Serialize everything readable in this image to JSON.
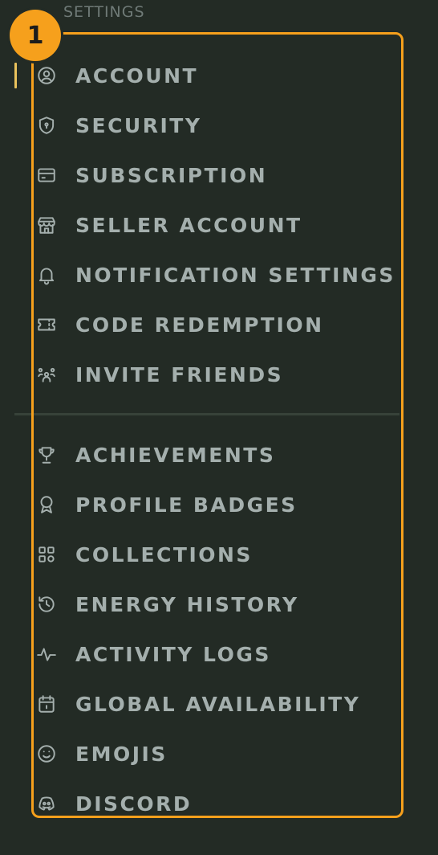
{
  "sidebar": {
    "section_header": "SETTINGS",
    "step_badge": "1",
    "colors": {
      "background": "#232b25",
      "text": "#a4afad",
      "header": "#6f7a77",
      "active_indicator": "#e9c25c",
      "highlight": "#f6a01c"
    },
    "group1": [
      {
        "label": "ACCOUNT",
        "icon": "user-circle-icon"
      },
      {
        "label": "SECURITY",
        "icon": "shield-icon"
      },
      {
        "label": "SUBSCRIPTION",
        "icon": "credit-card-icon"
      },
      {
        "label": "SELLER ACCOUNT",
        "icon": "store-icon"
      },
      {
        "label": "NOTIFICATION SETTINGS",
        "icon": "bell-icon"
      },
      {
        "label": "CODE REDEMPTION",
        "icon": "ticket-icon"
      },
      {
        "label": "INVITE FRIENDS",
        "icon": "users-icon"
      }
    ],
    "group2": [
      {
        "label": "ACHIEVEMENTS",
        "icon": "trophy-icon"
      },
      {
        "label": "PROFILE BADGES",
        "icon": "award-icon"
      },
      {
        "label": "COLLECTIONS",
        "icon": "grid-icon"
      },
      {
        "label": "ENERGY HISTORY",
        "icon": "history-icon"
      },
      {
        "label": "ACTIVITY LOGS",
        "icon": "activity-icon"
      },
      {
        "label": "GLOBAL AVAILABILITY",
        "icon": "calendar-icon"
      },
      {
        "label": "EMOJIS",
        "icon": "smile-icon"
      },
      {
        "label": "DISCORD",
        "icon": "discord-icon"
      }
    ]
  }
}
